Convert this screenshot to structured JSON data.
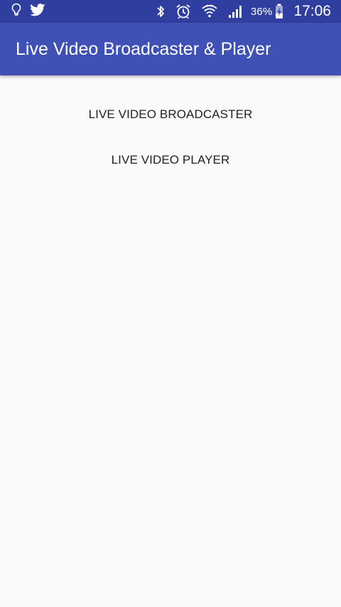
{
  "status_bar": {
    "left_icons": [
      "lightbulb-icon",
      "twitter-icon"
    ],
    "right_icons": [
      "bluetooth-icon",
      "alarm-icon",
      "wifi-icon",
      "signal-icon",
      "battery-charging-icon"
    ],
    "battery_percent": "36%",
    "time": "17:06"
  },
  "app_bar": {
    "title": "Live Video Broadcaster & Player"
  },
  "main": {
    "buttons": [
      {
        "label": "LIVE VIDEO BROADCASTER"
      },
      {
        "label": "LIVE VIDEO PLAYER"
      }
    ]
  },
  "colors": {
    "status_bar": "#303f9f",
    "app_bar": "#3f51b5",
    "background": "#fafafa",
    "button_text": "#222222"
  }
}
